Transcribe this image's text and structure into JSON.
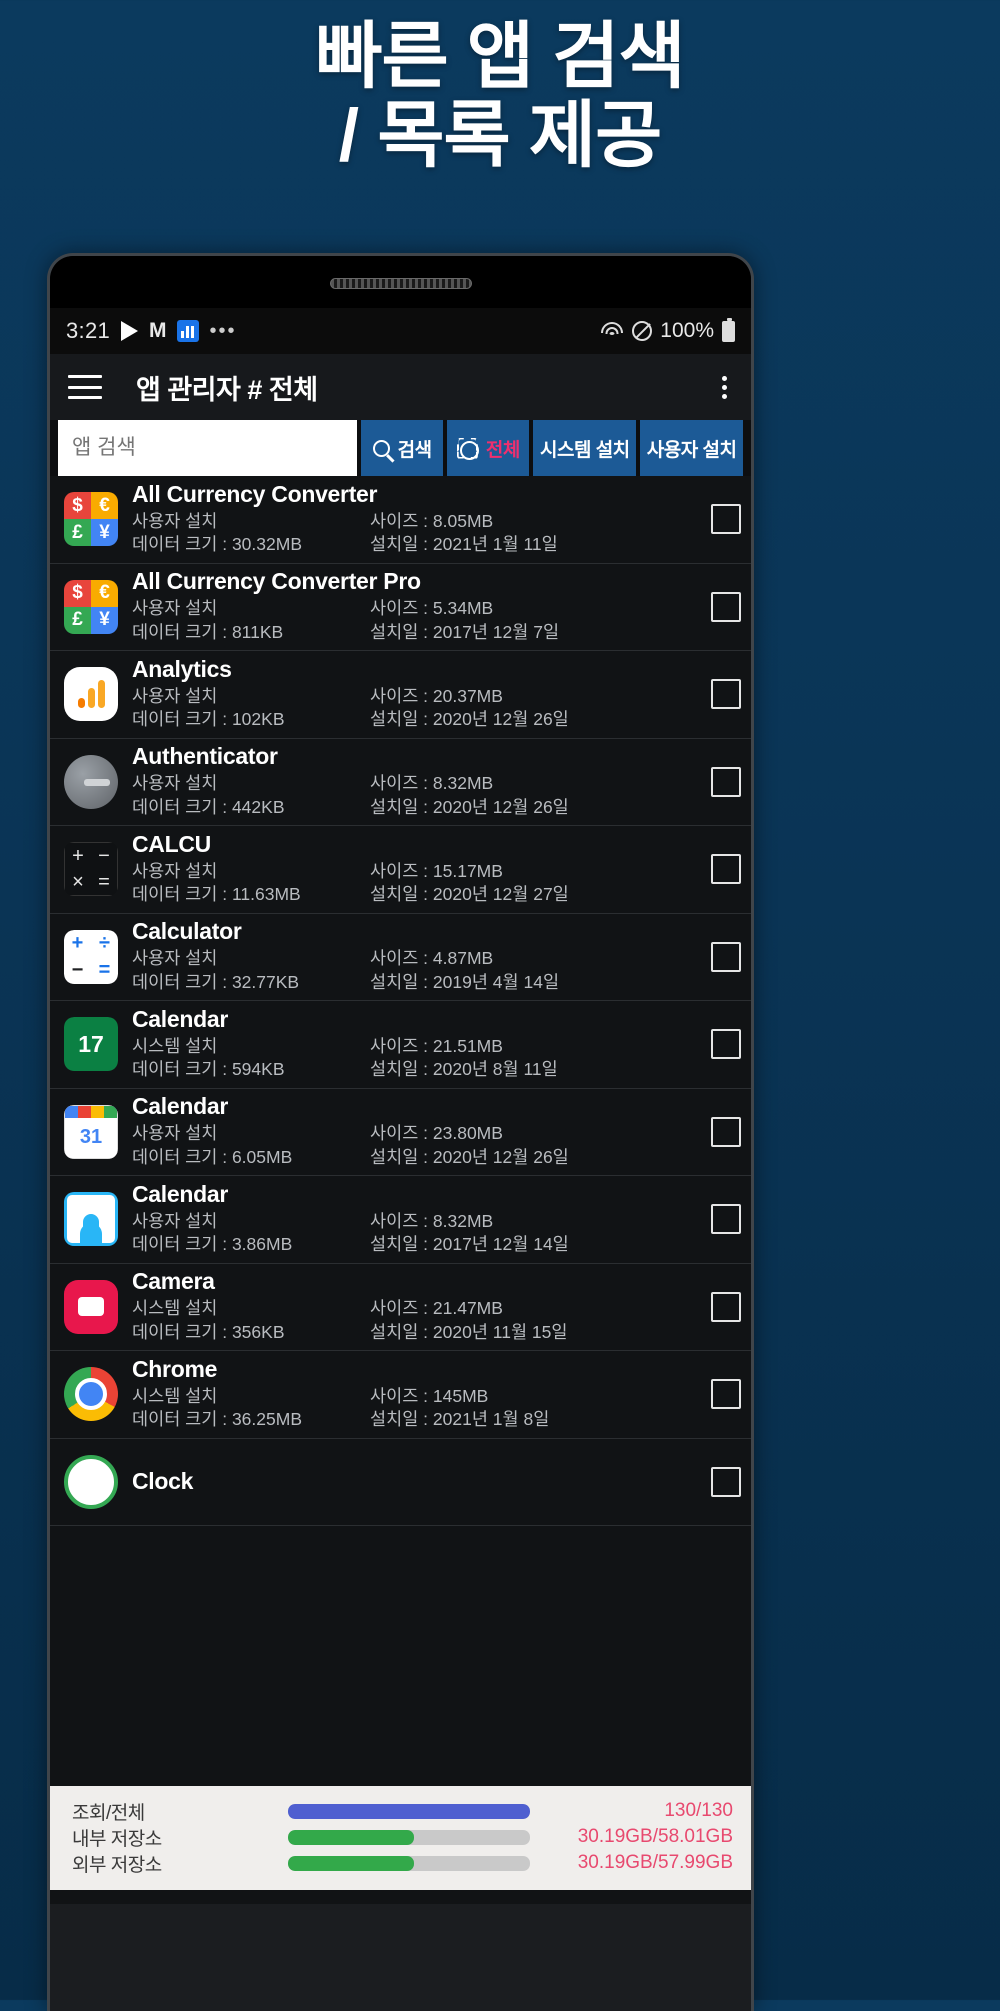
{
  "headline": {
    "line1": "빠른 앱 검색",
    "line2": "/ 목록 제공"
  },
  "statusbar": {
    "clock": "3:21",
    "gmail_glyph": "M",
    "dots": "•••",
    "battery_percent": "100%",
    "icons": [
      "play-store-icon",
      "gmail-icon",
      "chart-icon",
      "more-icon",
      "wifi-icon",
      "do-not-disturb-icon",
      "battery-icon"
    ]
  },
  "appbar": {
    "title": "앱 관리자 # 전체"
  },
  "toolbar": {
    "search_placeholder": "앱 검색",
    "search_value": "",
    "btn_search": "검색",
    "btn_all": "전체",
    "btn_system": "시스템 설치",
    "btn_user": "사용자 설치",
    "accent_color": "#ef2f6e",
    "button_bg": "#1c5a96"
  },
  "labels": {
    "size_prefix": "사이즈 : ",
    "data_prefix": "데이터 크기 : ",
    "installed_prefix": "설치일 : "
  },
  "apps": [
    {
      "name": "All Currency Converter",
      "install_type": "사용자 설치",
      "size": "사이즈 : 8.05MB",
      "data_size": "데이터 크기 : 30.32MB",
      "installed": "설치일 : 2021년 1월 11일",
      "icon": "currency-converter-icon"
    },
    {
      "name": "All Currency Converter Pro",
      "install_type": "사용자 설치",
      "size": "사이즈 : 5.34MB",
      "data_size": "데이터 크기 : 811KB",
      "installed": "설치일 : 2017년 12월 7일",
      "icon": "currency-converter-pro-icon"
    },
    {
      "name": "Analytics",
      "install_type": "사용자 설치",
      "size": "사이즈 : 20.37MB",
      "data_size": "데이터 크기 : 102KB",
      "installed": "설치일 : 2020년 12월 26일",
      "icon": "analytics-icon"
    },
    {
      "name": "Authenticator",
      "install_type": "사용자 설치",
      "size": "사이즈 : 8.32MB",
      "data_size": "데이터 크기 : 442KB",
      "installed": "설치일 : 2020년 12월 26일",
      "icon": "authenticator-icon"
    },
    {
      "name": "CALCU",
      "install_type": "사용자 설치",
      "size": "사이즈 : 15.17MB",
      "data_size": "데이터 크기 : 11.63MB",
      "installed": "설치일 : 2020년 12월 27일",
      "icon": "calcu-icon"
    },
    {
      "name": "Calculator",
      "install_type": "사용자 설치",
      "size": "사이즈 : 4.87MB",
      "data_size": "데이터 크기 : 32.77KB",
      "installed": "설치일 : 2019년 4월 14일",
      "icon": "calculator-icon"
    },
    {
      "name": "Calendar",
      "install_type": "시스템 설치",
      "size": "사이즈 : 21.51MB",
      "data_size": "데이터 크기 : 594KB",
      "installed": "설치일 : 2020년 8월 11일",
      "icon": "calendar-green-icon"
    },
    {
      "name": "Calendar",
      "install_type": "사용자 설치",
      "size": "사이즈 : 23.80MB",
      "data_size": "데이터 크기 : 6.05MB",
      "installed": "설치일 : 2020년 12월 26일",
      "icon": "calendar-google-icon"
    },
    {
      "name": "Calendar",
      "install_type": "사용자 설치",
      "size": "사이즈 : 8.32MB",
      "data_size": "데이터 크기 : 3.86MB",
      "installed": "설치일 : 2017년 12월 14일",
      "icon": "calendar-person-icon"
    },
    {
      "name": "Camera",
      "install_type": "시스템 설치",
      "size": "사이즈 : 21.47MB",
      "data_size": "데이터 크기 : 356KB",
      "installed": "설치일 : 2020년 11월 15일",
      "icon": "camera-icon"
    },
    {
      "name": "Chrome",
      "install_type": "시스템 설치",
      "size": "사이즈 : 145MB",
      "data_size": "데이터 크기 : 36.25MB",
      "installed": "설치일 : 2021년 1월 8일",
      "icon": "chrome-icon"
    }
  ],
  "bottom_status": {
    "rows": [
      {
        "label": "조회/전체",
        "value": "130/130",
        "percent": 100,
        "color": "#4f5fd0"
      },
      {
        "label": "내부 저장소",
        "value": "30.19GB/58.01GB",
        "percent": 52,
        "color": "#33a94a"
      },
      {
        "label": "외부 저장소",
        "value": "30.19GB/57.99GB",
        "percent": 52,
        "color": "#33a94a"
      }
    ]
  }
}
